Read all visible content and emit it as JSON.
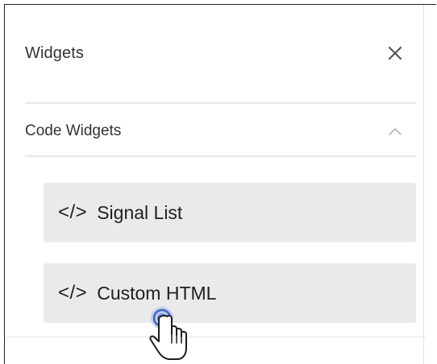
{
  "panel": {
    "title": "Widgets",
    "close_icon": "close-icon"
  },
  "section": {
    "title": "Code Widgets",
    "toggle_icon": "chevron-up-icon",
    "expanded": true
  },
  "widgets": [
    {
      "icon": "</>",
      "label": "Signal List"
    },
    {
      "icon": "</>",
      "label": "Custom HTML"
    }
  ],
  "pointer": {
    "icon": "hand-pointer-icon",
    "state": "click"
  },
  "colors": {
    "widget_bg": "#eaeaec",
    "text": "#333333",
    "divider": "#e8e8e8",
    "click_ring": "#4a6fd1"
  }
}
